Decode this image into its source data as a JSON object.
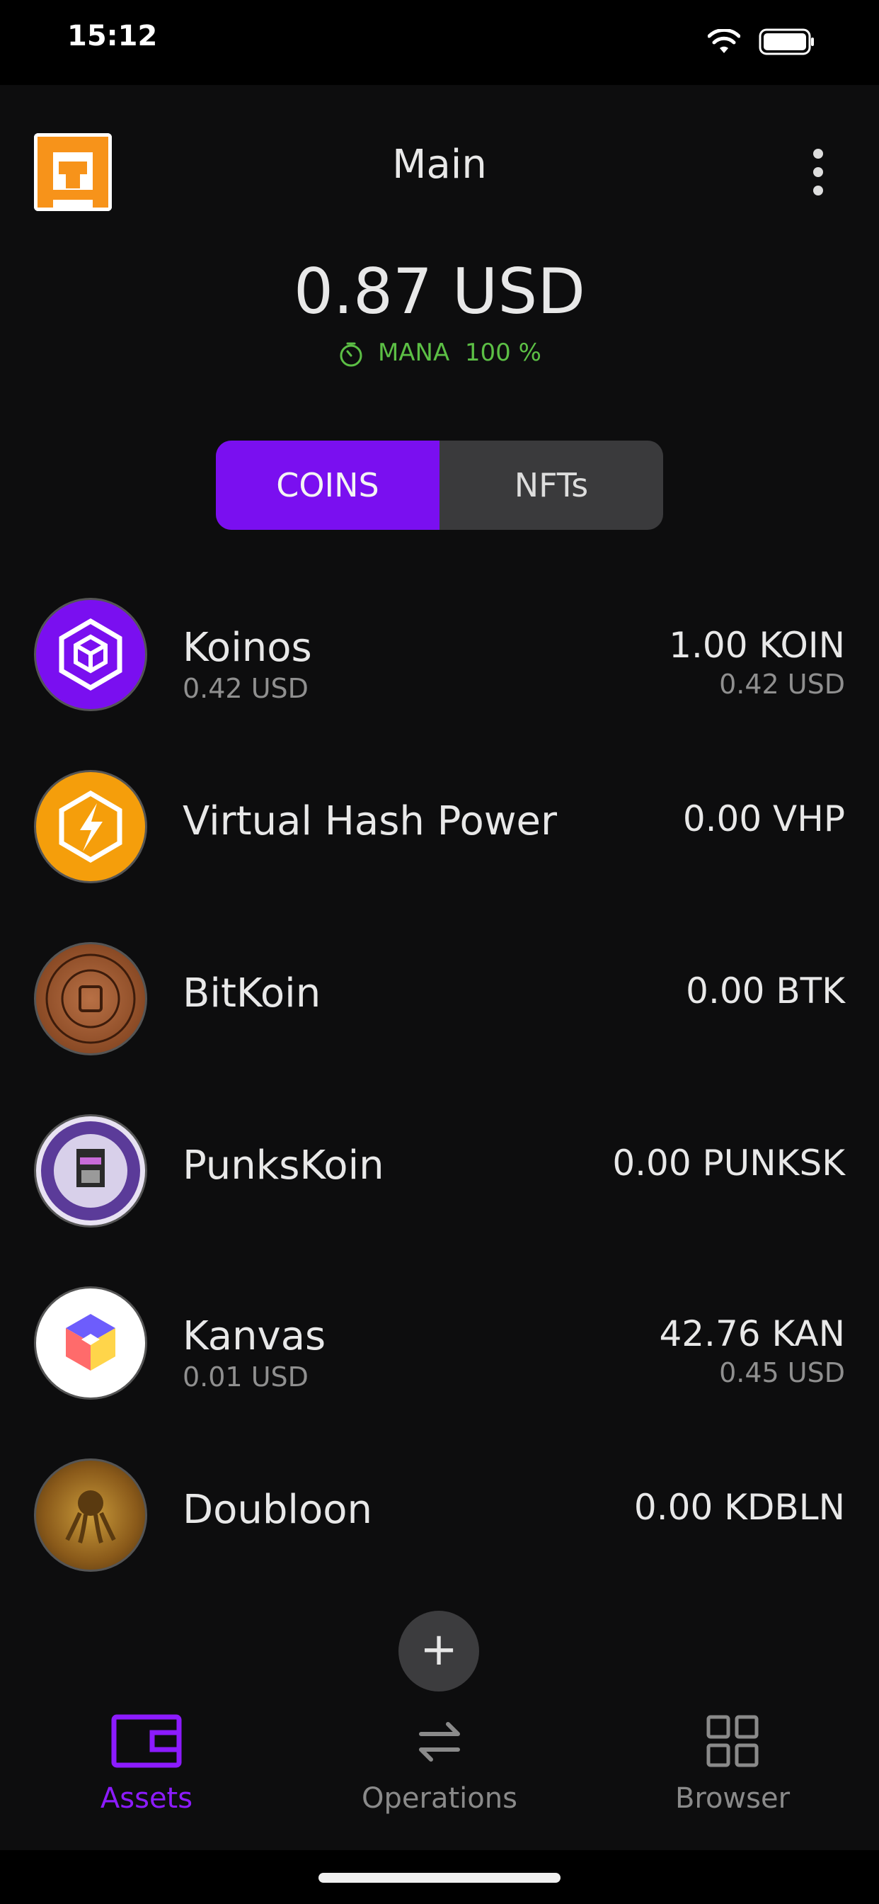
{
  "status": {
    "time": "15:12"
  },
  "header": {
    "title": "Main"
  },
  "summary": {
    "balance": "0.87 USD",
    "mana_label": "MANA",
    "mana_value": "100 %"
  },
  "segments": {
    "coins": "COINS",
    "nfts": "NFTs",
    "selected": "COINS"
  },
  "coins": [
    {
      "name": "Koinos",
      "fiat": "0.42 USD",
      "amount": "1.00 KOIN",
      "value": "0.42 USD"
    },
    {
      "name": "Virtual Hash Power",
      "amount": "0.00 VHP"
    },
    {
      "name": "BitKoin",
      "amount": "0.00 BTK"
    },
    {
      "name": "PunksKoin",
      "amount": "0.00 PUNKSK"
    },
    {
      "name": "Kanvas",
      "fiat": "0.01 USD",
      "amount": "42.76 KAN",
      "value": "0.45 USD"
    },
    {
      "name": "Doubloon",
      "amount": "0.00 KDBLN"
    }
  ],
  "tabs": [
    {
      "label": "Assets",
      "icon": "wallet-icon",
      "active": true
    },
    {
      "label": "Operations",
      "icon": "swap-arrows-icon",
      "active": false
    },
    {
      "label": "Browser",
      "icon": "grid-icon",
      "active": false
    }
  ],
  "colors": {
    "accent": "#7a0ff0",
    "mana": "#5cbf45",
    "background": "#0d0d0e"
  }
}
